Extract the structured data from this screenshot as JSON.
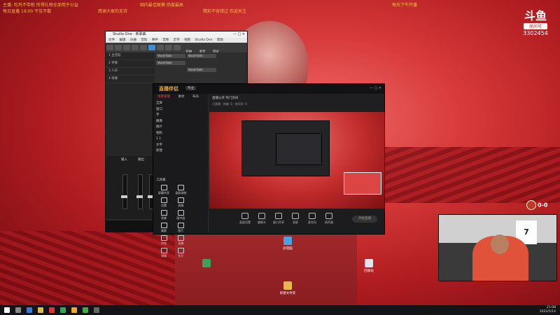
{
  "ticker": [
    "主播: 吃鸡不带枪 所得礼物全部用于公益",
    "国内最佳联赛 热度最高",
    "精彩不容错过 欢迎关注",
    "每日直播 19:00 不见不散",
    "感谢大家的支持",
    "每天下午开播"
  ],
  "douyu": {
    "logo_text": "斗鱼",
    "sub_label": "房间号",
    "room_number": "3302454"
  },
  "studio_one": {
    "title": "Studio One - 新歌曲",
    "menu": [
      "文件",
      "编辑",
      "乐曲",
      "音轨",
      "事件",
      "音频",
      "走带",
      "视图",
      "Studio One",
      "帮助"
    ],
    "toolbar_labels": [
      "开始",
      "混音",
      "浏览"
    ],
    "tracks": [
      "1 主音轨",
      "2 伴奏",
      "3 人声",
      "4 效果"
    ],
    "clips": [
      "Vocal-Solo",
      "Vocal-Solo",
      "Vocal-Solo",
      "Vocal-Solo"
    ],
    "mixer_labels": [
      "输入",
      "输出",
      "主"
    ],
    "timecode": "00001.01.01.00"
  },
  "obs": {
    "logo": "直播伴侣",
    "badge": "专业",
    "window_controls": "— □ ✕",
    "tabs": [
      {
        "label": "场景管理",
        "on": true
      },
      {
        "label": "素材",
        "on": false
      },
      {
        "label": "布局",
        "on": false
      }
    ],
    "layers": [
      "全屏",
      "窗口",
      "字",
      "摄像",
      "图片",
      "相机",
      "1 1",
      "文字",
      "新建"
    ],
    "tools_label": "工具箱",
    "tools": [
      "屏幕共享",
      "录屏录制",
      "设置",
      "表情",
      "背景",
      "画中画",
      "美颜",
      "图片",
      "特效",
      "直播",
      "弹幕",
      "多开"
    ],
    "room_title": "直播公开 热门房间",
    "room_sub": "已直播 · 热度: 0 · 房间号: 0",
    "controls": [
      "画面设置",
      "摄像头",
      "窗口共享",
      "录屏",
      "麦克风",
      "扬声器"
    ],
    "go_live": "开始直播"
  },
  "desktop_icons": [
    "此电脑",
    "回收站",
    "新建文件夹"
  ],
  "score": "0-0",
  "jersey": "7",
  "tray": {
    "time": "21:08",
    "date": "2022/5/14"
  }
}
